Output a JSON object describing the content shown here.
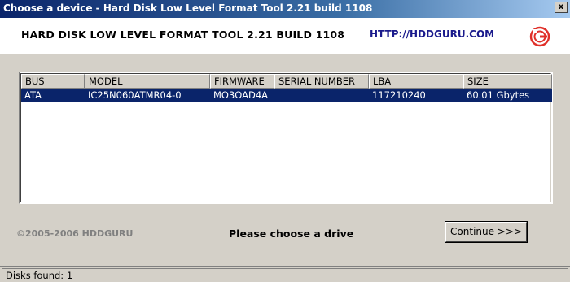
{
  "window": {
    "title": "Choose a device - Hard Disk Low Level Format Tool 2.21 build 1108",
    "close_glyph": "x"
  },
  "header": {
    "app_title": "HARD DISK LOW LEVEL FORMAT TOOL 2.21 BUILD 1108",
    "url": "HTTP://HDDGURU.COM",
    "logo_icon": "hddguru-logo-icon"
  },
  "devices": {
    "columns": [
      "BUS",
      "MODEL",
      "FIRMWARE",
      "SERIAL NUMBER",
      "LBA",
      "SIZE"
    ],
    "rows": [
      {
        "bus": "ATA",
        "model": "IC25N060ATMR04-0",
        "firmware": "MO3OAD4A",
        "serial": "",
        "lba": "117210240",
        "size": "60.01 Gbytes"
      }
    ]
  },
  "footer": {
    "copyright": "©2005-2006 HDDGURU",
    "prompt": "Please choose a drive",
    "continue_label": "Continue >>>"
  },
  "status": {
    "text": "Disks found: 1"
  },
  "colors": {
    "selection": "#0a246a",
    "url": "#1a1a8c",
    "logo_red": "#e0302a"
  }
}
